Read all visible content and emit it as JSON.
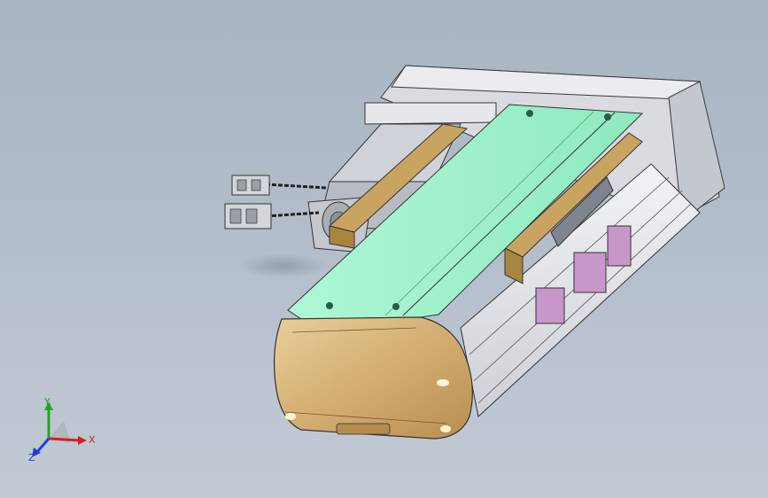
{
  "viewport": {
    "background_top": "#a9b4c2",
    "background_bottom": "#c2cad4"
  },
  "model": {
    "colors": {
      "carriage_green": "#9cf5cc",
      "endcap_gold": "#d5b079",
      "mount_plate_gold": "#c9a460",
      "motor_housing_grey": "#cfd3d9",
      "profile_silver": "#e7e8ec",
      "sensor_purple": "#c896c8"
    }
  },
  "triad": {
    "y_label": "Y",
    "x_label": "X",
    "z_label": "Z",
    "colors": {
      "x": "#d42020",
      "y": "#1fa81f",
      "z": "#2040d0"
    }
  }
}
